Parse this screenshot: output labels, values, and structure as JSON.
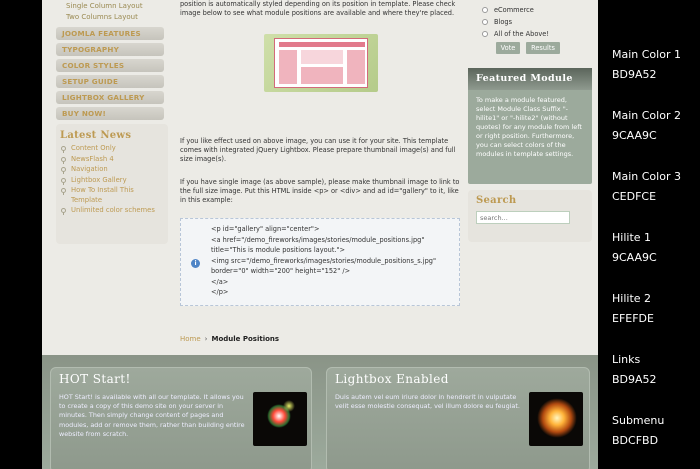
{
  "menu": {
    "sub_items": [
      "Single Column Layout",
      "Two Columns Layout"
    ],
    "main_items": [
      "JOOMLA FEATURES",
      "TYPOGRAPHY",
      "COLOR STYLES",
      "SETUP GUIDE",
      "LIGHTBOX GALLERY",
      "BUY NOW!"
    ]
  },
  "latest_news": {
    "title": "Latest News",
    "items": [
      "Content Only",
      "NewsFlash 4",
      "Navigation",
      "Lightbox Gallery",
      "How To Install This",
      "Template",
      "Unlimited color schemes"
    ]
  },
  "main": {
    "intro": "position is automatically styled depending on its position in template. Please check image below to see what module positions are available and where they're placed.",
    "para1": "If you like effect used on above image, you can use it for your site. This template comes with integrated jQuery Lightbox. Please prepare thumbnail image(s) and full size image(s).",
    "para2": "If you have single image (as above sample), please make thumbnail image to link to the full size image. Put this HTML inside <p> or <div> and ad id=\"gallery\" to it, like in this example:",
    "code_lines": [
      "<p id=\"gallery\" align=\"center\">",
      "<a href=\"/demo_fireworks/images/stories/module_positions.jpg\"",
      "title=\"This is module positions layout.\">",
      "<img src=\"/demo_fireworks/images/stories/module_positions_s.jpg\"",
      "border=\"0\" width=\"200\" height=\"152\" />",
      "</a>",
      "</p>"
    ],
    "info_glyph": "i"
  },
  "breadcrumb": {
    "home": "Home",
    "separator": "›",
    "current": "Module Positions"
  },
  "poll": {
    "options": [
      "eCommerce",
      "Blogs",
      "All of the Above!"
    ],
    "vote_label": "Vote",
    "results_label": "Results"
  },
  "featured": {
    "title": "Featured Module",
    "body": "To make a module featured, select Module Class Suffix \"-hilite1\" or \"-hilite2\" (without quotes) for any module from left or right position. Furthermore, you can select colors of the modules in template settings."
  },
  "search": {
    "title": "Search",
    "placeholder": "search..."
  },
  "bottom": {
    "hot_title": "HOT Start!",
    "hot_text": "HOT Start! is available with all our template. It allows you to create a copy of this demo site on your server in minutes. Then simply change content of pages and modules, add or remove them, rather than building entire website from scratch.",
    "lightbox_title": "Lightbox Enabled",
    "lightbox_text": "Duis autem vel eum iriure dolor in hendrerit in vulputate velit esse molestie consequat, vel illum dolore eu feugiat."
  },
  "legend": [
    {
      "label": "Main Color 1",
      "value": "BD9A52"
    },
    {
      "label": "Main Color 2",
      "value": "9CAA9C"
    },
    {
      "label": "Main Color 3",
      "value": "CEDFCE"
    },
    {
      "label": "Hilite 1",
      "value": "9CAA9C"
    },
    {
      "label": "Hilite 2",
      "value": "EFEFDE"
    },
    {
      "label": "Links",
      "value": "BD9A52"
    },
    {
      "label": "Submenu",
      "value": "BDCFBD"
    }
  ],
  "colors": {
    "main1": "#BD9A52",
    "main2": "#9CAA9C",
    "main3": "#CEDFCE",
    "hilite2": "#EFEFDE",
    "submenu": "#BDCFBD"
  },
  "icons": {
    "news_bullet": "pin-icon",
    "poll_radio": "radio-icon",
    "code_info": "info-icon"
  }
}
